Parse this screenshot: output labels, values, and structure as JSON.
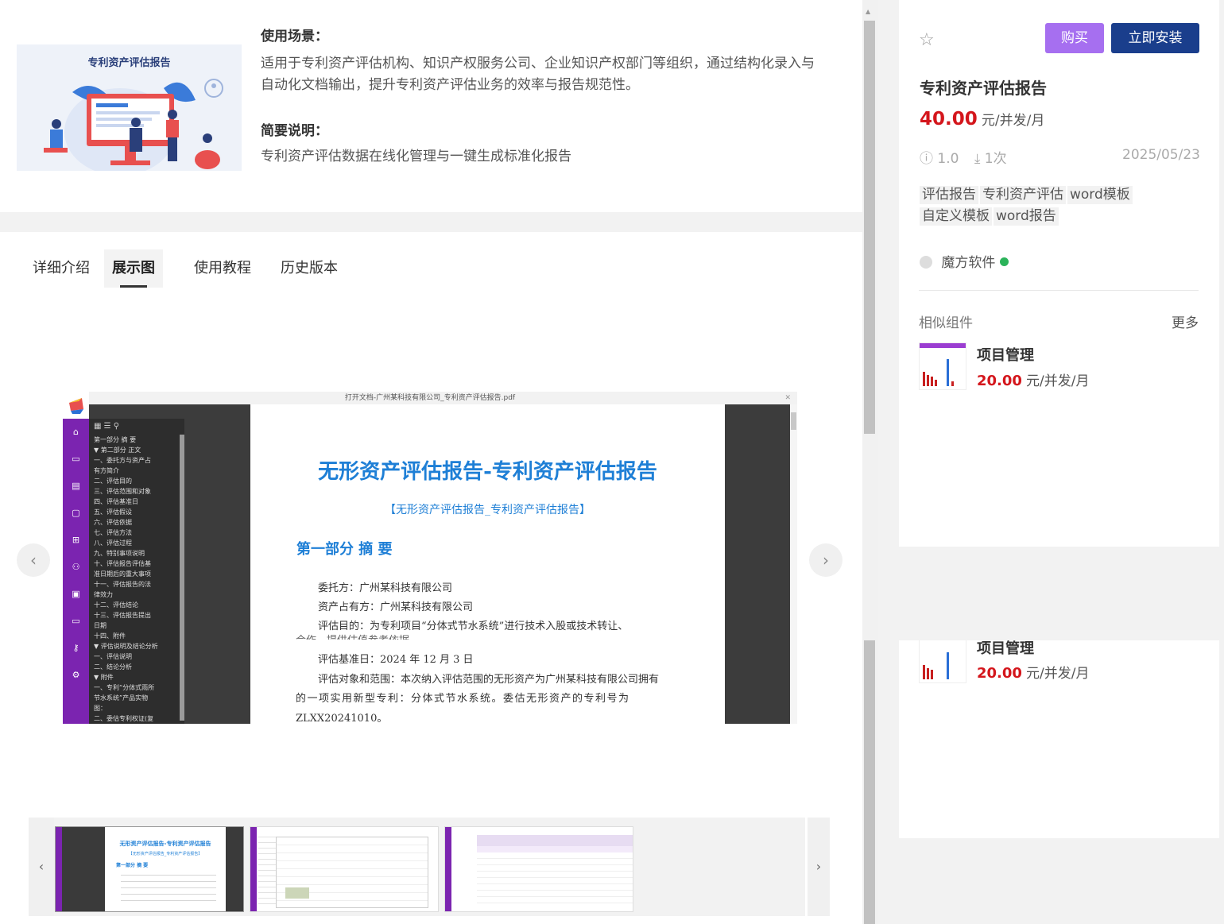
{
  "top": {
    "hero_title": "专利资产评估报告",
    "scenario_title": "使用场景：",
    "scenario_text_1": "适用于专利资产评估机构、知识产权服务公司、企业知识产权部门等组织，通过结构化录入与",
    "scenario_text_2": "自动化文档输出，提升专利资产评估业务的效率与报告规范性。",
    "brief_title": "简要说明：",
    "brief_text": "专利资产评估数据在线化管理与一键生成标准化报告"
  },
  "tabs": [
    {
      "label": "详细介绍",
      "active": false
    },
    {
      "label": "展示图",
      "active": true
    },
    {
      "label": "使用教程",
      "active": false
    },
    {
      "label": "历史版本",
      "active": false
    }
  ],
  "carousel": {
    "prev": "‹",
    "next": "›"
  },
  "viewer": {
    "title": "打开文档-广州某科技有限公司_专利资产评估报告.pdf",
    "outline": [
      "第一部分 摘 要",
      "▼ 第二部分 正文",
      "    一、委托方与资产占",
      "    有方简介",
      "    二、评估目的",
      "    三、评估范围和对象",
      "    四、评估基准日",
      "    五、评估假设",
      "    六、评估依据",
      "    七、评估方法",
      "    八、评估过程",
      "    九、特别事项说明",
      "    十、评估报告评估基",
      "    准日期后的重大事项",
      "    十一、评估报告的法",
      "    律效力",
      "    十二、评估结论",
      "    十三、评估报告提出",
      "    日期",
      "    十四、附件",
      "▼ 评估说明及结论分析",
      "    一、评估说明",
      "    二、结论分析",
      "▼ 附件",
      "    一、专利“分体式雨所",
      "    节水系统”产品实物",
      "    图：",
      "    二、委估专利权证(复"
    ],
    "doc_title": "无形资产评估报告-专利资产评估报告",
    "doc_subtitle": "【无形资产评估报告_专利资产评估报告】",
    "doc_section": "第一部分  摘  要",
    "lines": [
      "委托方：广州某科技有限公司",
      "资产占有方：广州某科技有限公司",
      "评估目的：为专利项目“分体式节水系统”进行技术入股或技术转让、",
      "合作，提供估值参考依据",
      "评估基准日：2024 年 12 月 3 日",
      "评估对象和范围：本次纳入评估范围的无形资产为广州某科技有限公司拥有",
      "的一项实用新型专利：分体式节水系统。委估无形资产的专利号为",
      "ZLXX20241010。"
    ]
  },
  "thumbnails": {
    "prev": "‹",
    "next": "›",
    "thumb1_title": "无形资产评估报告-专利资产评估报告",
    "thumb1_subtitle": "【无形资产评估报告_专利资产评估报告】",
    "thumb1_section": "第一部分 摘 要"
  },
  "sidebar": {
    "buy_label": "购买",
    "install_label": "立即安装",
    "product_title": "专利资产评估报告",
    "price": "40.00",
    "price_unit": "元/并发/月",
    "version": "1.0",
    "downloads": "1次",
    "date": "2025/05/23",
    "tags": [
      "评估报告",
      "专利资产评估",
      "word模板",
      "自定义模板",
      "word报告"
    ],
    "author": "魔方软件",
    "similar_label": "相似组件",
    "more_label": "更多",
    "similar_items": [
      {
        "name": "项目管理",
        "price": "20.00",
        "unit": "元/并发/月"
      }
    ]
  },
  "colors": {
    "buy": "#a66ff0",
    "install": "#1a3e8c",
    "price": "#d4161c",
    "doc_blue": "#1e7fd6",
    "rail_purple": "#7b24b0"
  }
}
